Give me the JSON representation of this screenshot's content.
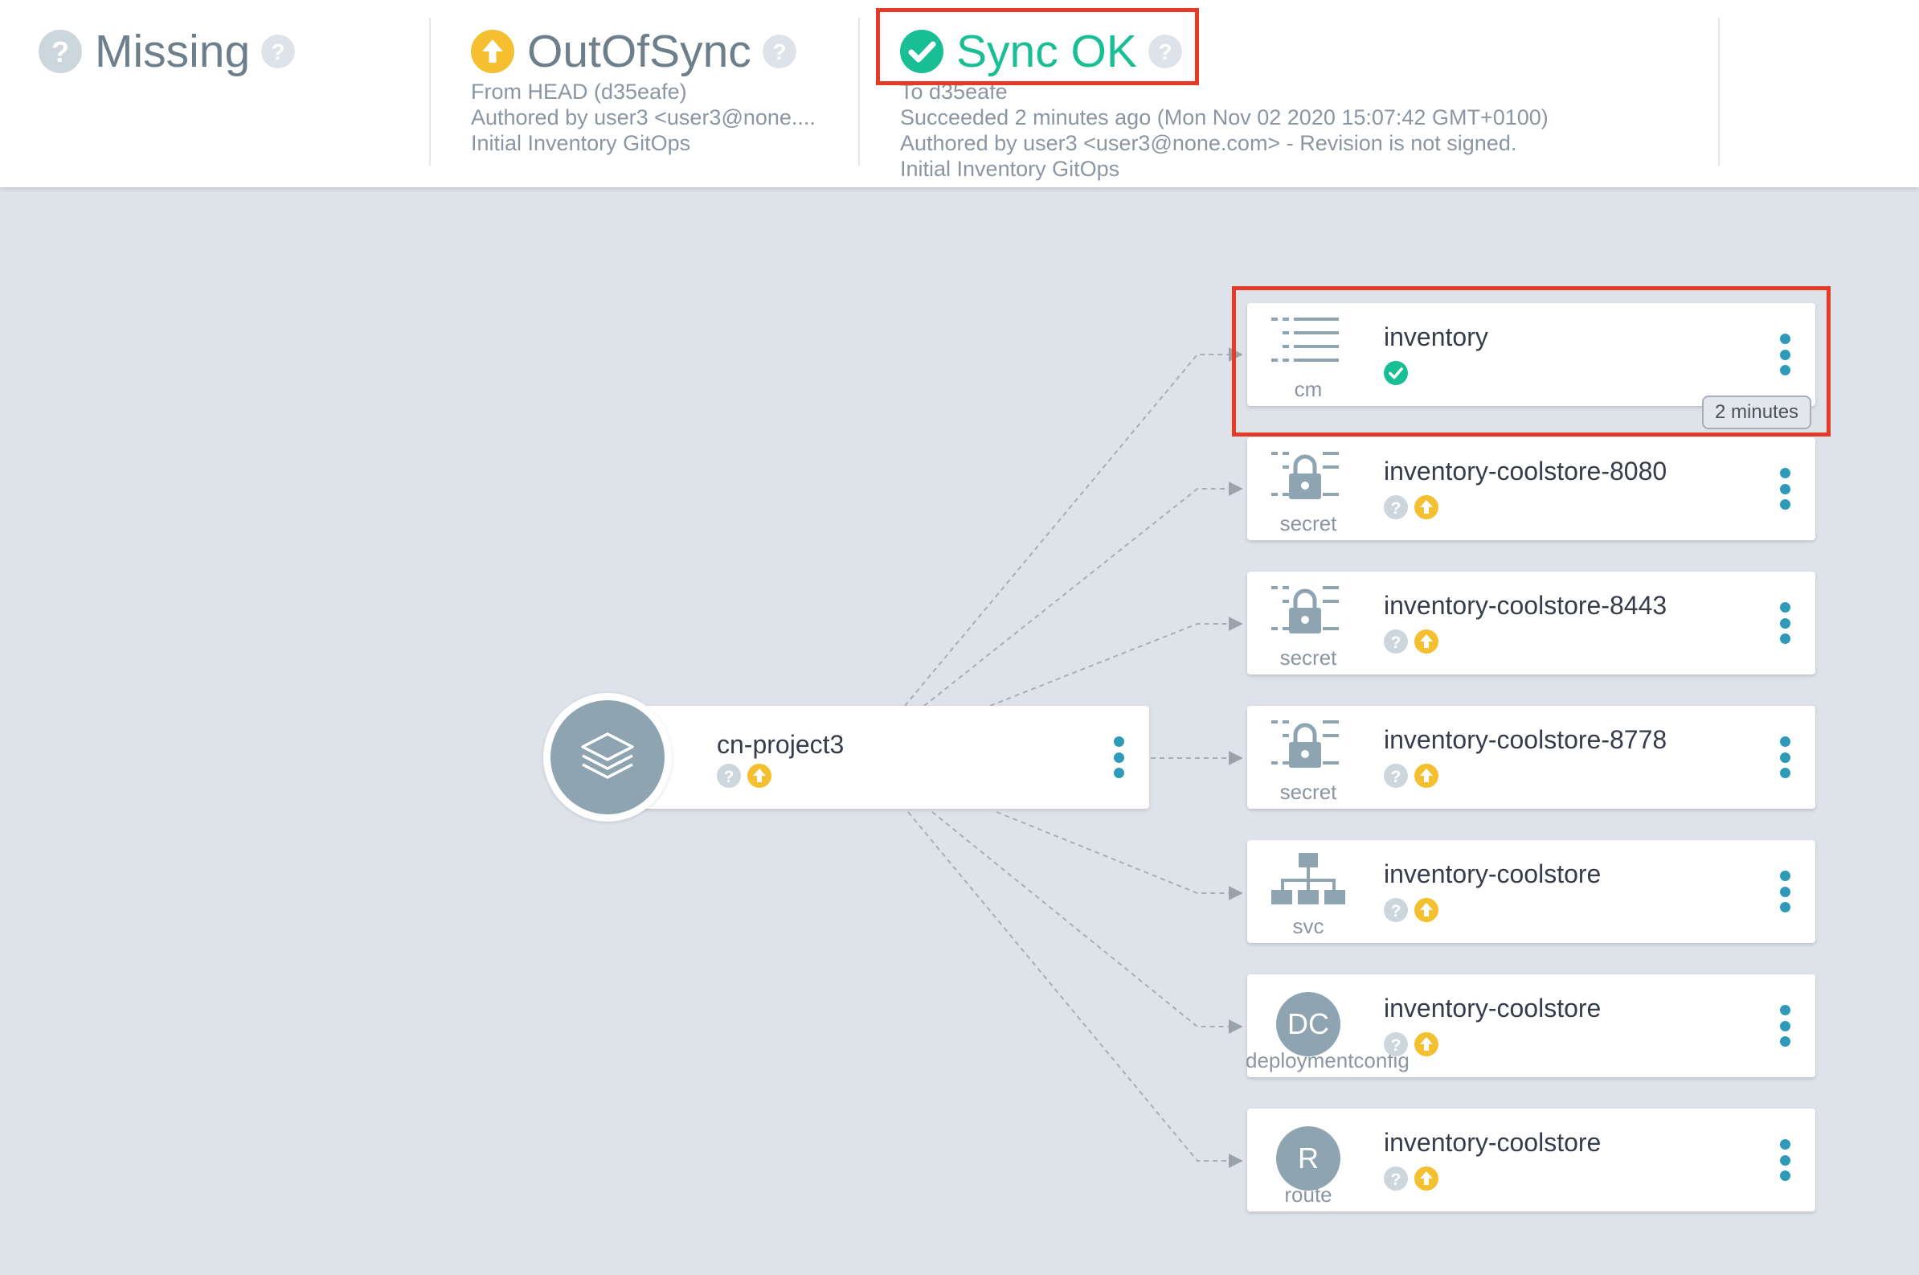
{
  "header": {
    "health": {
      "label": "Missing",
      "icon": "question-circle-icon"
    },
    "sync_status": {
      "label": "OutOfSync",
      "icon": "arrow-up-circle-icon",
      "lines": [
        "From HEAD (d35eafe)",
        "Authored by user3 <user3@none....",
        "Initial Inventory GitOps"
      ]
    },
    "last_sync": {
      "label": "Sync OK",
      "icon": "check-circle-icon",
      "lines": [
        "To d35eafe",
        "Succeeded 2 minutes ago (Mon Nov 02 2020 15:07:42 GMT+0100)",
        "Authored by user3 <user3@none.com> - Revision is not signed.",
        "Initial Inventory GitOps"
      ]
    }
  },
  "app": {
    "name": "cn-project3",
    "icon": "layers-icon"
  },
  "resources": [
    {
      "name": "inventory",
      "kind": "cm",
      "icon": "configmap-icon",
      "status": [
        "synced"
      ],
      "age": "2 minutes"
    },
    {
      "name": "inventory-coolstore-8080",
      "kind": "secret",
      "icon": "secret-icon",
      "status": [
        "unknown",
        "outofsync"
      ]
    },
    {
      "name": "inventory-coolstore-8443",
      "kind": "secret",
      "icon": "secret-icon",
      "status": [
        "unknown",
        "outofsync"
      ]
    },
    {
      "name": "inventory-coolstore-8778",
      "kind": "secret",
      "icon": "secret-icon",
      "status": [
        "unknown",
        "outofsync"
      ]
    },
    {
      "name": "inventory-coolstore",
      "kind": "svc",
      "icon": "service-icon",
      "status": [
        "unknown",
        "outofsync"
      ]
    },
    {
      "name": "inventory-coolstore",
      "kind": "deploymentconfig",
      "icon": "deploymentconfig-icon",
      "badge": "DC",
      "status": [
        "unknown",
        "outofsync"
      ]
    },
    {
      "name": "inventory-coolstore",
      "kind": "route",
      "icon": "route-icon",
      "badge": "R",
      "status": [
        "unknown",
        "outofsync"
      ]
    }
  ],
  "colors": {
    "synced": "#18be94",
    "outofsync": "#f4c030",
    "unknown": "#ccd6dd",
    "kebab": "#2e9ab7",
    "annotation": "#e53a25"
  }
}
